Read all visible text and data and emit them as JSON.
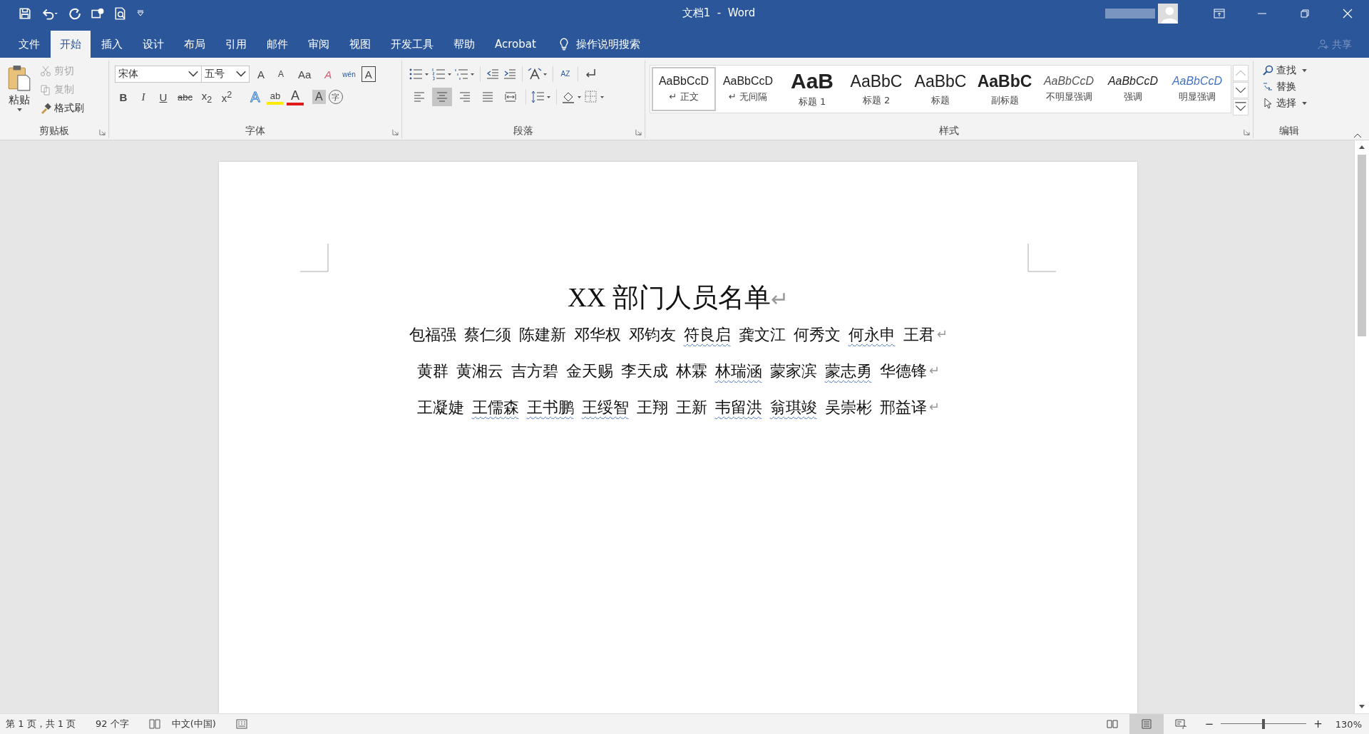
{
  "window": {
    "title": "文档1  -  Word"
  },
  "ribbon_tabs": [
    {
      "label": "文件",
      "selected": false
    },
    {
      "label": "开始",
      "selected": true
    },
    {
      "label": "插入",
      "selected": false
    },
    {
      "label": "设计",
      "selected": false
    },
    {
      "label": "布局",
      "selected": false
    },
    {
      "label": "引用",
      "selected": false
    },
    {
      "label": "邮件",
      "selected": false
    },
    {
      "label": "审阅",
      "selected": false
    },
    {
      "label": "视图",
      "selected": false
    },
    {
      "label": "开发工具",
      "selected": false
    },
    {
      "label": "帮助",
      "selected": false
    },
    {
      "label": "Acrobat",
      "selected": false
    }
  ],
  "tell_me": {
    "placeholder": "操作说明搜索"
  },
  "share": {
    "label": "共享"
  },
  "clipboard": {
    "paste": "粘贴",
    "group_label": "剪贴板",
    "tools": [
      {
        "label": "剪切",
        "kind": "cut",
        "disabled": true
      },
      {
        "label": "复制",
        "kind": "copy",
        "disabled": true
      },
      {
        "label": "格式刷",
        "kind": "painter",
        "disabled": false
      }
    ]
  },
  "font": {
    "name": "宋体",
    "size": "五号",
    "group_label": "字体",
    "row1": [
      {
        "label": "A",
        "kind": "grow"
      },
      {
        "label": "A",
        "kind": "shrink"
      },
      {
        "label": "Aa",
        "kind": "case"
      },
      {
        "label": "A",
        "kind": "clear"
      },
      {
        "label": "wén",
        "kind": "phonetic"
      },
      {
        "label": "A",
        "kind": "border"
      }
    ],
    "row2": [
      {
        "label": "B",
        "kind": "bold"
      },
      {
        "label": "I",
        "kind": "italic"
      },
      {
        "label": "U",
        "kind": "underline"
      },
      {
        "label": "abc",
        "kind": "strike"
      },
      {
        "label": "x$_{2}$",
        "kind": "script"
      },
      {
        "label": "x$^{2}$",
        "kind": "script"
      },
      {
        "label": "A",
        "kind": "effect"
      },
      {
        "label": "ab",
        "kind": "highlight"
      },
      {
        "label": "A",
        "kind": "color"
      },
      {
        "label": "A",
        "kind": "shade"
      },
      {
        "label": "字",
        "kind": "enclose"
      }
    ]
  },
  "paragraph": {
    "group_label": "段落",
    "sort_label": "AZ",
    "alignments": [
      {
        "kind": "left",
        "selected": false
      },
      {
        "kind": "center",
        "selected": true
      },
      {
        "kind": "right",
        "selected": false
      },
      {
        "kind": "justify",
        "selected": false
      },
      {
        "kind": "distribute",
        "selected": false
      }
    ]
  },
  "styles": {
    "group_label": "样式",
    "items": [
      {
        "preview": "AaBbCcD",
        "name": "↵ 正文",
        "kind": "normal",
        "selected": true
      },
      {
        "preview": "AaBbCcD",
        "name": "↵ 无间隔",
        "kind": "normal",
        "selected": false
      },
      {
        "preview": "AaB",
        "name": "标题 1",
        "kind": "heading1",
        "selected": false
      },
      {
        "preview": "AaBbC",
        "name": "标题 2",
        "kind": "heading2",
        "selected": false
      },
      {
        "preview": "AaBbC",
        "name": "标题",
        "kind": "title",
        "selected": false
      },
      {
        "preview": "AaBbC",
        "name": "副标题",
        "kind": "subtitle",
        "selected": false
      },
      {
        "preview": "AaBbCcD",
        "name": "不明显强调",
        "kind": "subtle",
        "selected": false
      },
      {
        "preview": "AaBbCcD",
        "name": "强调",
        "kind": "emphasis",
        "selected": false
      },
      {
        "preview": "AaBbCcD",
        "name": "明显强调",
        "kind": "intense",
        "selected": false
      }
    ]
  },
  "editing": {
    "group_label": "编辑",
    "tools": [
      {
        "label": "查找",
        "kind": "find",
        "dropdown": true
      },
      {
        "label": "替换",
        "kind": "replace",
        "dropdown": false
      },
      {
        "label": "选择",
        "kind": "select",
        "dropdown": true
      }
    ]
  },
  "document": {
    "title": "XX 部门人员名单",
    "end_mark": "↵",
    "paragraphs": [
      {
        "names": [
          {
            "text": "包福强",
            "flagged": false
          },
          {
            "text": "蔡仁须",
            "flagged": false
          },
          {
            "text": "陈建新",
            "flagged": false
          },
          {
            "text": "邓华权",
            "flagged": false
          },
          {
            "text": "邓钧友",
            "flagged": false
          },
          {
            "text": "符良启",
            "flagged": true
          },
          {
            "text": "龚文江",
            "flagged": false
          },
          {
            "text": "何秀文",
            "flagged": false
          },
          {
            "text": "何永申",
            "flagged": true
          },
          {
            "text": "王君",
            "flagged": false
          }
        ],
        "end_mark": "↵"
      },
      {
        "names": [
          {
            "text": "黄群",
            "flagged": false
          },
          {
            "text": "黄湘云",
            "flagged": false
          },
          {
            "text": "吉方碧",
            "flagged": false
          },
          {
            "text": "金天赐",
            "flagged": false
          },
          {
            "text": "李天成",
            "flagged": false
          },
          {
            "text": "林霖",
            "flagged": false
          },
          {
            "text": "林瑞涵",
            "flagged": true
          },
          {
            "text": "蒙家滨",
            "flagged": false
          },
          {
            "text": "蒙志勇",
            "flagged": true
          },
          {
            "text": "华德锋",
            "flagged": false
          }
        ],
        "end_mark": "↵"
      },
      {
        "names": [
          {
            "text": "王凝婕",
            "flagged": false
          },
          {
            "text": "王儒森",
            "flagged": true
          },
          {
            "text": "王书鹏",
            "flagged": true
          },
          {
            "text": "王绥智",
            "flagged": true
          },
          {
            "text": "王翔",
            "flagged": false
          },
          {
            "text": "王新",
            "flagged": false
          },
          {
            "text": "韦留洪",
            "flagged": true
          },
          {
            "text": "翁琪竣",
            "flagged": true
          },
          {
            "text": "吴崇彬",
            "flagged": false
          },
          {
            "text": "邢益译",
            "flagged": false
          }
        ],
        "end_mark": "↵"
      }
    ]
  },
  "status_bar": {
    "page": "第 1 页，共 1 页",
    "words": "92 个字",
    "language": "中文(中国)",
    "views": [
      {
        "kind": "read",
        "selected": false
      },
      {
        "kind": "print",
        "selected": true
      },
      {
        "kind": "web",
        "selected": false
      }
    ],
    "zoom_out": "−",
    "zoom_in": "+",
    "zoom": {
      "level": 0.5,
      "reading": "130%"
    }
  }
}
